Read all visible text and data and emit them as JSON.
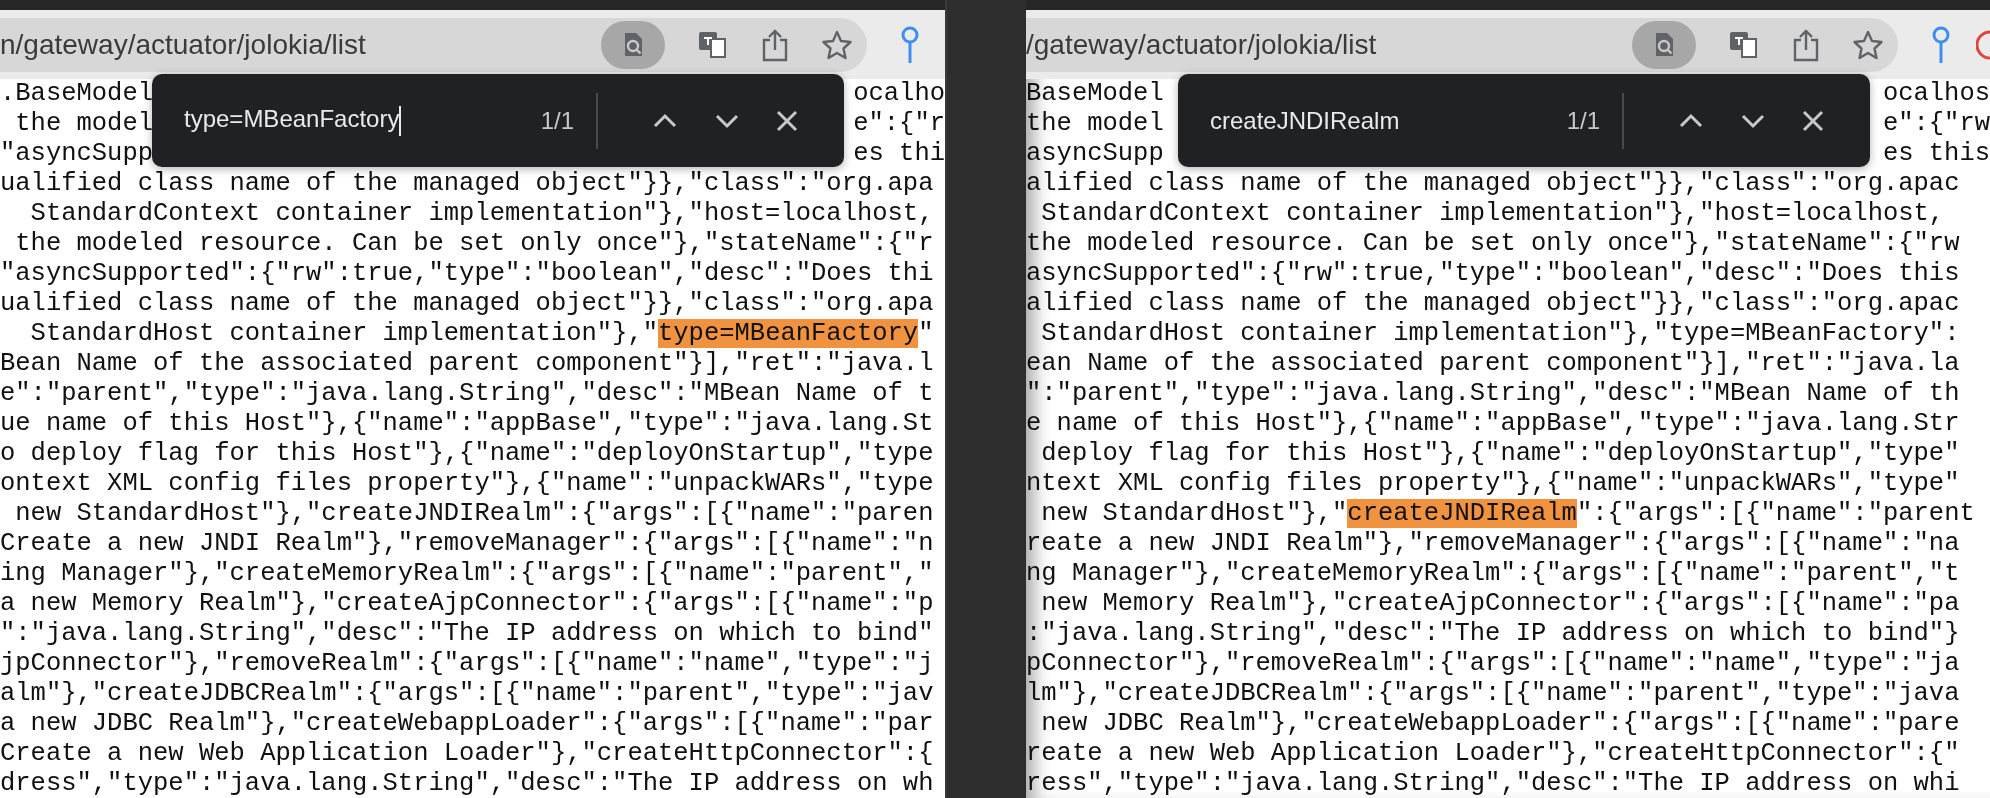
{
  "windows": [
    {
      "address": "n/gateway/actuator/jolokia/list",
      "extension_icon_visible": false,
      "find_bar": {
        "query": "type=MBeanFactory",
        "focused": true,
        "count": "1/1"
      },
      "lines": [
        {
          "kind": "split",
          "start": ".BaseModel",
          "end": "ocalho"
        },
        {
          "kind": "split",
          "start": " the model",
          "end": "e\":{\"r"
        },
        {
          "kind": "split",
          "start": "\"asyncSupp",
          "end": "es thi"
        },
        {
          "kind": "plain",
          "text": "ualified class name of the managed object\"}},\"class\":\"org.apa"
        },
        {
          "kind": "plain",
          "text": "  StandardContext container implementation\"},\"host=localhost,"
        },
        {
          "kind": "plain",
          "text": " the modeled resource. Can be set only once\"},\"stateName\":{\"r"
        },
        {
          "kind": "plain",
          "text": "\"asyncSupported\":{\"rw\":true,\"type\":\"boolean\",\"desc\":\"Does thi"
        },
        {
          "kind": "plain",
          "text": "ualified class name of the managed object\"}},\"class\":\"org.apa"
        },
        {
          "kind": "match",
          "before": "  StandardHost container implementation\"},\"",
          "match": "type=MBeanFactory",
          "after": "\""
        },
        {
          "kind": "plain",
          "text": "Bean Name of the associated parent component\"}],\"ret\":\"java.l"
        },
        {
          "kind": "plain",
          "text": "e\":\"parent\",\"type\":\"java.lang.String\",\"desc\":\"MBean Name of t"
        },
        {
          "kind": "plain",
          "text": "ue name of this Host\"},{\"name\":\"appBase\",\"type\":\"java.lang.St"
        },
        {
          "kind": "plain",
          "text": "o deploy flag for this Host\"},{\"name\":\"deployOnStartup\",\"type"
        },
        {
          "kind": "plain",
          "text": "ontext XML config files property\"},{\"name\":\"unpackWARs\",\"type"
        },
        {
          "kind": "plain",
          "text": " new StandardHost\"},\"createJNDIRealm\":{\"args\":[{\"name\":\"paren"
        },
        {
          "kind": "plain",
          "text": "Create a new JNDI Realm\"},\"removeManager\":{\"args\":[{\"name\":\"n"
        },
        {
          "kind": "plain",
          "text": "ing Manager\"},\"createMemoryRealm\":{\"args\":[{\"name\":\"parent\",\""
        },
        {
          "kind": "plain",
          "text": "a new Memory Realm\"},\"createAjpConnector\":{\"args\":[{\"name\":\"p"
        },
        {
          "kind": "plain",
          "text": "\":\"java.lang.String\",\"desc\":\"The IP address on which to bind\""
        },
        {
          "kind": "plain",
          "text": "jpConnector\"},\"removeRealm\":{\"args\":[{\"name\":\"name\",\"type\":\"j"
        },
        {
          "kind": "plain",
          "text": "alm\"},\"createJDBCRealm\":{\"args\":[{\"name\":\"parent\",\"type\":\"jav"
        },
        {
          "kind": "plain",
          "text": "a new JDBC Realm\"},\"createWebappLoader\":{\"args\":[{\"name\":\"par"
        },
        {
          "kind": "plain",
          "text": "Create a new Web Application Loader\"},\"createHttpConnector\":{"
        },
        {
          "kind": "plain",
          "text": "dress\",\"type\":\"java.lang.String\",\"desc\":\"The IP address on wh"
        }
      ]
    },
    {
      "address": "/gateway/actuator/jolokia/list",
      "extension_icon_visible": true,
      "find_bar": {
        "query": "createJNDIRealm",
        "focused": false,
        "count": "1/1"
      },
      "lines": [
        {
          "kind": "split",
          "start": "BaseModel",
          "end": "ocalhos"
        },
        {
          "kind": "split",
          "start": "the model",
          "end": "e\":{\"rw"
        },
        {
          "kind": "split",
          "start": "asyncSupp",
          "end": "es this"
        },
        {
          "kind": "plain",
          "text": "alified class name of the managed object\"}},\"class\":\"org.apac"
        },
        {
          "kind": "plain",
          "text": " StandardContext container implementation\"},\"host=localhost,"
        },
        {
          "kind": "plain",
          "text": "the modeled resource. Can be set only once\"},\"stateName\":{\"rw"
        },
        {
          "kind": "plain",
          "text": "asyncSupported\":{\"rw\":true,\"type\":\"boolean\",\"desc\":\"Does this"
        },
        {
          "kind": "plain",
          "text": "alified class name of the managed object\"}},\"class\":\"org.apac"
        },
        {
          "kind": "plain",
          "text": " StandardHost container implementation\"},\"type=MBeanFactory\":"
        },
        {
          "kind": "plain",
          "text": "ean Name of the associated parent component\"}],\"ret\":\"java.la"
        },
        {
          "kind": "plain",
          "text": "\":\"parent\",\"type\":\"java.lang.String\",\"desc\":\"MBean Name of th"
        },
        {
          "kind": "plain",
          "text": "e name of this Host\"},{\"name\":\"appBase\",\"type\":\"java.lang.Str"
        },
        {
          "kind": "plain",
          "text": " deploy flag for this Host\"},{\"name\":\"deployOnStartup\",\"type\""
        },
        {
          "kind": "plain",
          "text": "ntext XML config files property\"},{\"name\":\"unpackWARs\",\"type\""
        },
        {
          "kind": "match",
          "before": " new StandardHost\"},\"",
          "match": "createJNDIRealm",
          "after": "\":{\"args\":[{\"name\":\"parent"
        },
        {
          "kind": "plain",
          "text": "reate a new JNDI Realm\"},\"removeManager\":{\"args\":[{\"name\":\"na"
        },
        {
          "kind": "plain",
          "text": "ng Manager\"},\"createMemoryRealm\":{\"args\":[{\"name\":\"parent\",\"t"
        },
        {
          "kind": "plain",
          "text": " new Memory Realm\"},\"createAjpConnector\":{\"args\":[{\"name\":\"pa"
        },
        {
          "kind": "plain",
          "text": ":\"java.lang.String\",\"desc\":\"The IP address on which to bind\"}"
        },
        {
          "kind": "plain",
          "text": "pConnector\"},\"removeRealm\":{\"args\":[{\"name\":\"name\",\"type\":\"ja"
        },
        {
          "kind": "plain",
          "text": "lm\"},\"createJDBCRealm\":{\"args\":[{\"name\":\"parent\",\"type\":\"java"
        },
        {
          "kind": "plain",
          "text": " new JDBC Realm\"},\"createWebappLoader\":{\"args\":[{\"name\":\"pare"
        },
        {
          "kind": "plain",
          "text": "reate a new Web Application Loader\"},\"createHttpConnector\":{\""
        },
        {
          "kind": "plain",
          "text": "ress\",\"type\":\"java.lang.String\",\"desc\":\"The IP address on whi"
        }
      ]
    }
  ]
}
